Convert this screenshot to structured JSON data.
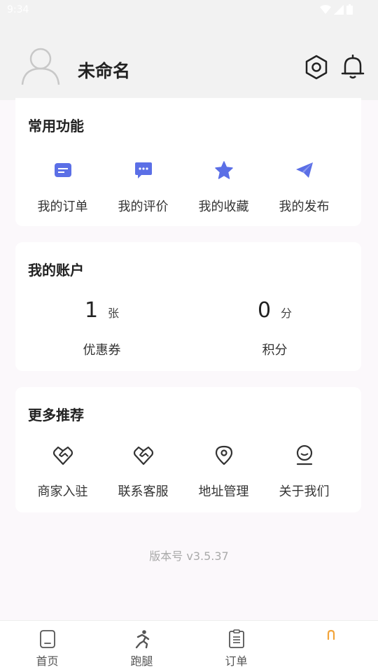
{
  "status_bar": {
    "time": "9:34"
  },
  "profile": {
    "username": "未命名"
  },
  "common_functions": {
    "title": "常用功能",
    "items": [
      {
        "label": "我的订单",
        "icon": "order-list-icon"
      },
      {
        "label": "我的评价",
        "icon": "comment-icon"
      },
      {
        "label": "我的收藏",
        "icon": "star-icon"
      },
      {
        "label": "我的发布",
        "icon": "send-icon"
      }
    ]
  },
  "account": {
    "title": "我的账户",
    "coupon": {
      "value": "1",
      "unit": "张",
      "label": "优惠券"
    },
    "points": {
      "value": "0",
      "unit": "分",
      "label": "积分"
    }
  },
  "more": {
    "title": "更多推荐",
    "items": [
      {
        "label": "商家入驻",
        "icon": "handshake-icon"
      },
      {
        "label": "联系客服",
        "icon": "handshake-icon"
      },
      {
        "label": "地址管理",
        "icon": "location-pin-icon"
      },
      {
        "label": "关于我们",
        "icon": "user-smile-icon"
      }
    ]
  },
  "version": "版本号 v3.5.37",
  "tabbar": {
    "items": [
      {
        "label": "首页",
        "icon": "home-icon"
      },
      {
        "label": "跑腿",
        "icon": "runner-icon"
      },
      {
        "label": "订单",
        "icon": "clipboard-icon"
      },
      {
        "label": "",
        "icon": "profile-icon"
      }
    ]
  },
  "colors": {
    "accent": "#5b6fe6",
    "icon_gray": "#333333",
    "active_tab": "#f2a43a"
  }
}
